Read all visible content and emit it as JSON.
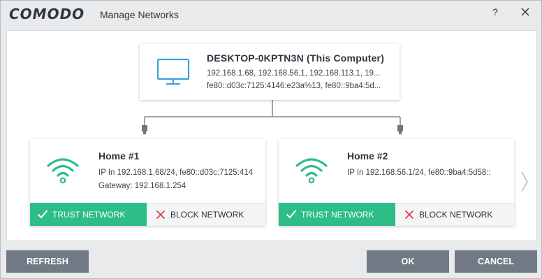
{
  "window": {
    "brand": "COMODO",
    "title": "Manage Networks",
    "help_label": "?",
    "close_icon": "close-icon"
  },
  "computer": {
    "name": "DESKTOP-0KPTN3N (This Computer)",
    "ipv4": "192.168.1.68, 192.168.56.1, 192.168.113.1, 19...",
    "ipv6": "fe80::d03c:7125:4146:e23a%13, fe80::9ba4:5d...",
    "icon": "monitor-icon"
  },
  "networks": [
    {
      "name": "Home #1",
      "ip": "IP In 192.168.1.68/24, fe80::d03c:7125:414",
      "gateway": "Gateway: 192.168.1.254",
      "trust_label": "TRUST NETWORK",
      "block_label": "BLOCK NETWORK",
      "trusted": true
    },
    {
      "name": "Home #2",
      "ip": "IP In 192.168.56.1/24, fe80::9ba4:5d58::",
      "gateway": "",
      "trust_label": "TRUST NETWORK",
      "block_label": "BLOCK NETWORK",
      "trusted": true
    }
  ],
  "footer": {
    "refresh_label": "REFRESH",
    "ok_label": "OK",
    "cancel_label": "CANCEL"
  },
  "colors": {
    "accent_green": "#2dbd86",
    "icon_blue": "#3aa3dd",
    "button_gray": "#727a86"
  }
}
